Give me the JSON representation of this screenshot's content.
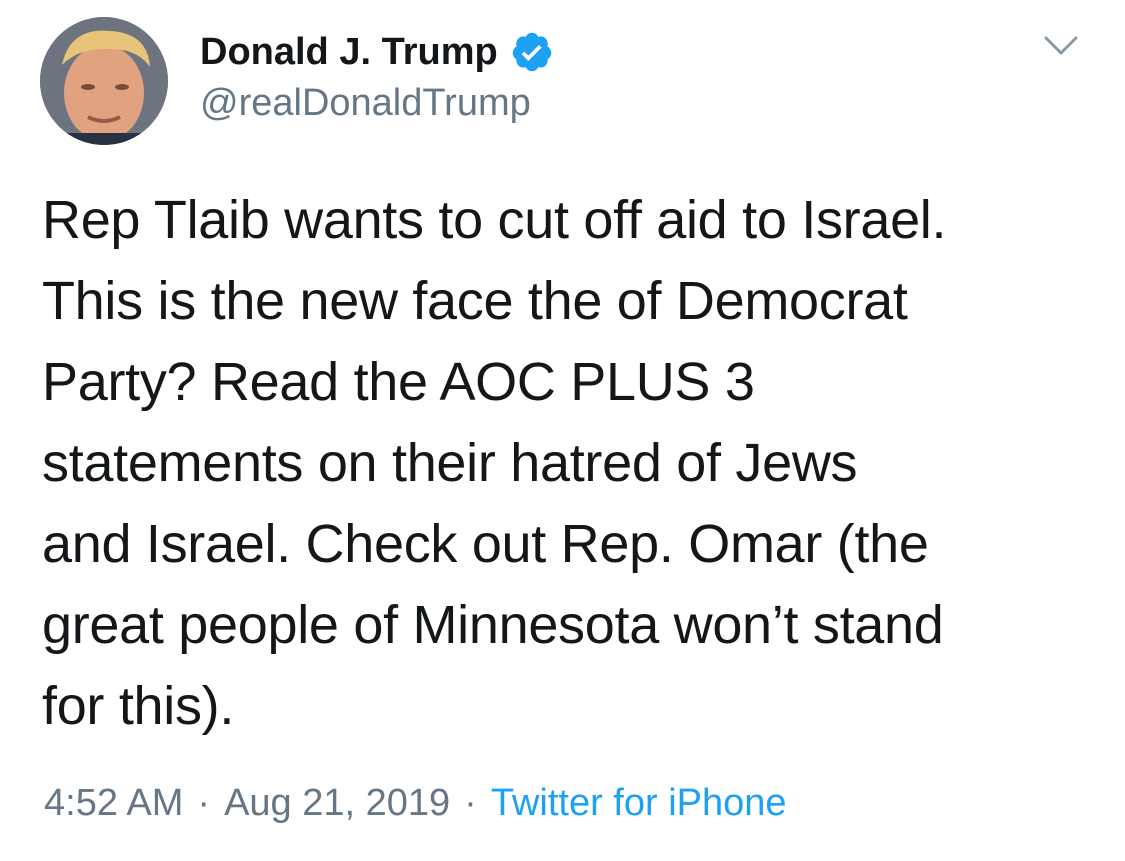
{
  "author": {
    "display_name": "Donald J. Trump",
    "handle": "@realDonaldTrump",
    "verified": true,
    "verified_color": "#1da1f2"
  },
  "icons": {
    "avatar": "profile-photo",
    "verified": "verified-badge-icon",
    "menu": "chevron-down-icon"
  },
  "tweet": {
    "text": "Rep Tlaib wants to cut off aid to Israel.\nThis is the new face the of Democrat\nParty? Read the AOC PLUS 3\nstatements on their hatred of Jews\nand Israel. Check out Rep. Omar (the\ngreat people of Minnesota won’t stand\nfor this).",
    "time": "4:52 AM",
    "date": "Aug 21, 2019",
    "separator": "·",
    "source": "Twitter for iPhone"
  },
  "colors": {
    "text_primary": "#14171a",
    "text_secondary": "#657786",
    "link": "#1da1f2"
  }
}
